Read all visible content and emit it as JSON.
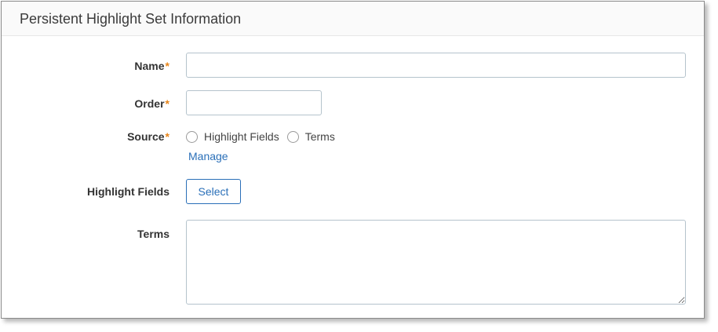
{
  "header": {
    "title": "Persistent Highlight Set Information"
  },
  "form": {
    "name": {
      "label": "Name",
      "required_mark": "*",
      "value": ""
    },
    "order": {
      "label": "Order",
      "required_mark": "*",
      "value": ""
    },
    "source": {
      "label": "Source",
      "required_mark": "*",
      "options": [
        "Highlight Fields",
        "Terms"
      ],
      "manage_link": "Manage"
    },
    "highlight_fields": {
      "label": "Highlight Fields",
      "button_label": "Select"
    },
    "terms": {
      "label": "Terms",
      "value": ""
    }
  },
  "colors": {
    "required": "#e8861b",
    "link": "#2a6fb8",
    "border": "#b5c3cc"
  }
}
